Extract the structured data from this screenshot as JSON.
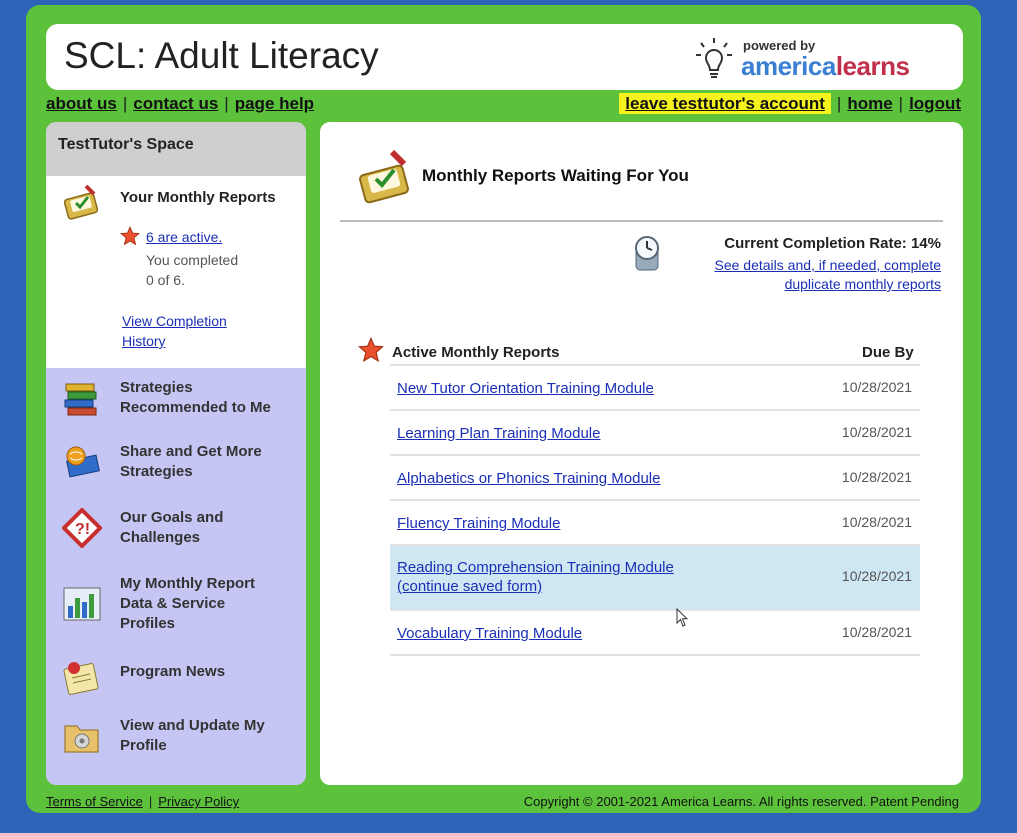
{
  "header": {
    "app_title": "SCL: Adult Literacy",
    "powered_by": "powered by",
    "brand_part1": "america",
    "brand_part2": "learns"
  },
  "topnav": {
    "about": "about us",
    "contact": "contact us",
    "page_help": "page help",
    "leave": "leave testtutor's account",
    "home": "home",
    "logout": "logout"
  },
  "sidebar": {
    "title": "TestTutor's Space",
    "monthly_reports": {
      "label": "Your Monthly Reports",
      "active_link": "6 are active.",
      "completed_line1": "You completed",
      "completed_line2": "0 of 6.",
      "history_line1": "View Completion",
      "history_line2": "History"
    },
    "items": [
      {
        "line1": "Strategies",
        "line2": "Recommended to Me",
        "line3": "",
        "icon": "books-icon"
      },
      {
        "line1": "Share and Get More",
        "line2": "Strategies",
        "line3": "",
        "icon": "book-globe-icon"
      },
      {
        "line1": "Our Goals and",
        "line2": "Challenges",
        "line3": "",
        "icon": "warning-sign-icon"
      },
      {
        "line1": "My Monthly Report",
        "line2": "Data & Service",
        "line3": "Profiles",
        "icon": "bar-chart-icon"
      },
      {
        "line1": "Program News",
        "line2": "",
        "line3": "",
        "icon": "news-icon"
      },
      {
        "line1": "View and Update My",
        "line2": "Profile",
        "line3": "",
        "icon": "profile-folder-icon"
      }
    ]
  },
  "content": {
    "title": "Monthly Reports Waiting For You",
    "completion_rate": "Current Completion Rate: 14%",
    "details_line1": "See details and, if needed, complete",
    "details_line2": "duplicate monthly reports",
    "table_header_left": "Active Monthly Reports",
    "table_header_right": "Due By",
    "rows": [
      {
        "title": "New Tutor Orientation Training Module",
        "sub": "",
        "due": "10/28/2021"
      },
      {
        "title": "Learning Plan Training Module",
        "sub": "",
        "due": "10/28/2021"
      },
      {
        "title": "Alphabetics or Phonics Training Module",
        "sub": "",
        "due": "10/28/2021"
      },
      {
        "title": "Fluency Training Module",
        "sub": "",
        "due": "10/28/2021"
      },
      {
        "title": "Reading Comprehension Training Module",
        "sub": "(continue saved form)",
        "due": "10/28/2021"
      },
      {
        "title": "Vocabulary Training Module",
        "sub": "",
        "due": "10/28/2021"
      }
    ]
  },
  "footer": {
    "terms": "Terms of Service",
    "privacy": "Privacy Policy",
    "copyright": "Copyright © 2001-2021 America Learns. All rights reserved. Patent Pending"
  },
  "colors": {
    "frame_green": "#5cc23c",
    "page_blue": "#2f63b8",
    "sidebar_lavender": "#c6c6f4",
    "link_blue": "#1a2fb5",
    "highlight_yellow": "#f6f21d",
    "selected_row": "#cfe7f3"
  }
}
